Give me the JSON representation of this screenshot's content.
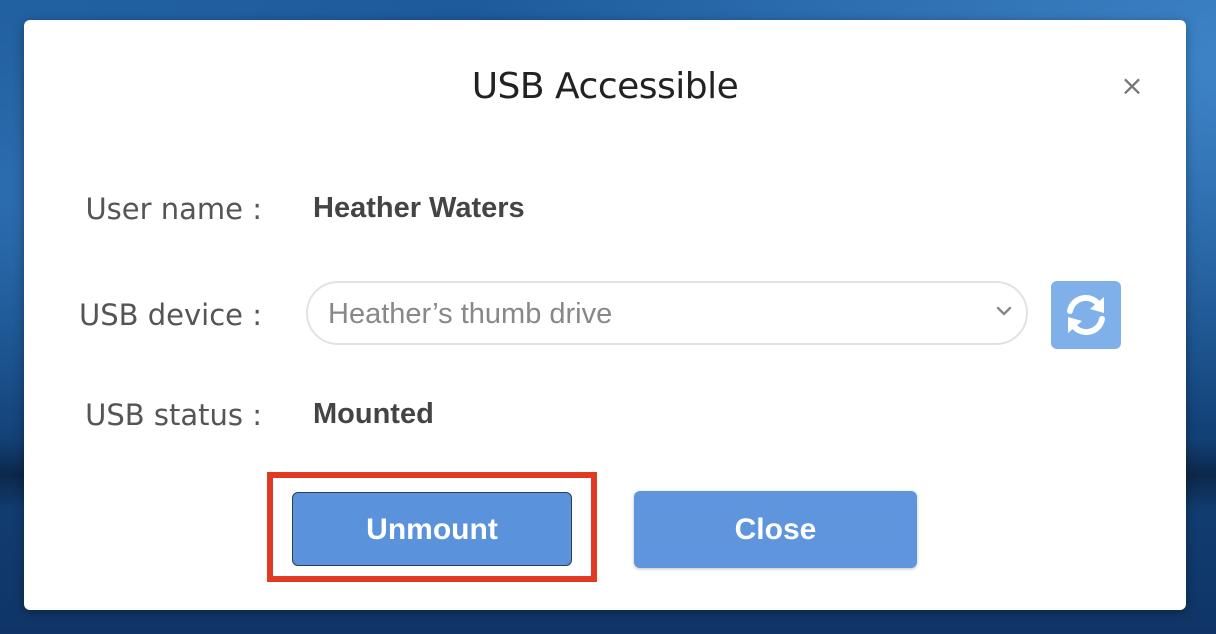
{
  "dialog": {
    "title": "USB Accessible",
    "close_icon": "×"
  },
  "fields": {
    "user_name": {
      "label": "User name :",
      "value": "Heather Waters"
    },
    "usb_device": {
      "label": "USB device :",
      "selected": "Heather’s thumb drive"
    },
    "usb_status": {
      "label": "USB status :",
      "value": "Mounted"
    }
  },
  "buttons": {
    "unmount": "Unmount",
    "close": "Close"
  },
  "icons": {
    "refresh": "refresh-icon",
    "dropdown": "chevron-down-icon",
    "close": "close-icon"
  },
  "colors": {
    "button_blue": "#5b92dc",
    "refresh_blue": "#7fb0ea",
    "highlight_red": "#e03a22"
  }
}
